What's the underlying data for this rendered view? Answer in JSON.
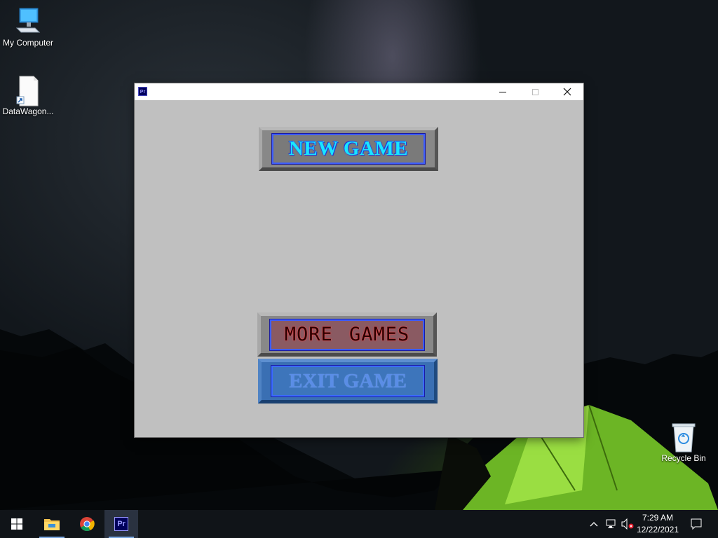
{
  "desktop": {
    "icons": [
      {
        "label": "My Computer",
        "icon": "computer-icon"
      },
      {
        "label": "DataWagon...",
        "icon": "shortcut-file-icon"
      },
      {
        "label": "Recycle Bin",
        "icon": "recycle-bin-icon"
      }
    ]
  },
  "window": {
    "app_icon_text": "Pr",
    "controls": {
      "minimize": "minimize",
      "maximize": "maximize",
      "close": "close"
    }
  },
  "game_menu": {
    "new_game": "NEW GAME",
    "more_games": "MORE GAMES",
    "exit_game": "EXIT GAME"
  },
  "taskbar": {
    "start_icon": "windows-start-icon",
    "pinned": [
      {
        "name": "file-explorer-icon"
      },
      {
        "name": "chrome-icon"
      },
      {
        "name": "premiere-pro-icon",
        "text": "Pr",
        "active": true
      }
    ],
    "tray_icons": [
      "chevron-up-icon",
      "network-icon",
      "volume-muted-icon",
      "notifications-icon"
    ],
    "time": "7:29 AM",
    "date": "12/22/2021"
  },
  "colors": {
    "window_bg": "#c0c0c0",
    "new_game_text": "#19e6ff",
    "exit_button": "#3a6fb3",
    "taskbar": "#101418"
  }
}
